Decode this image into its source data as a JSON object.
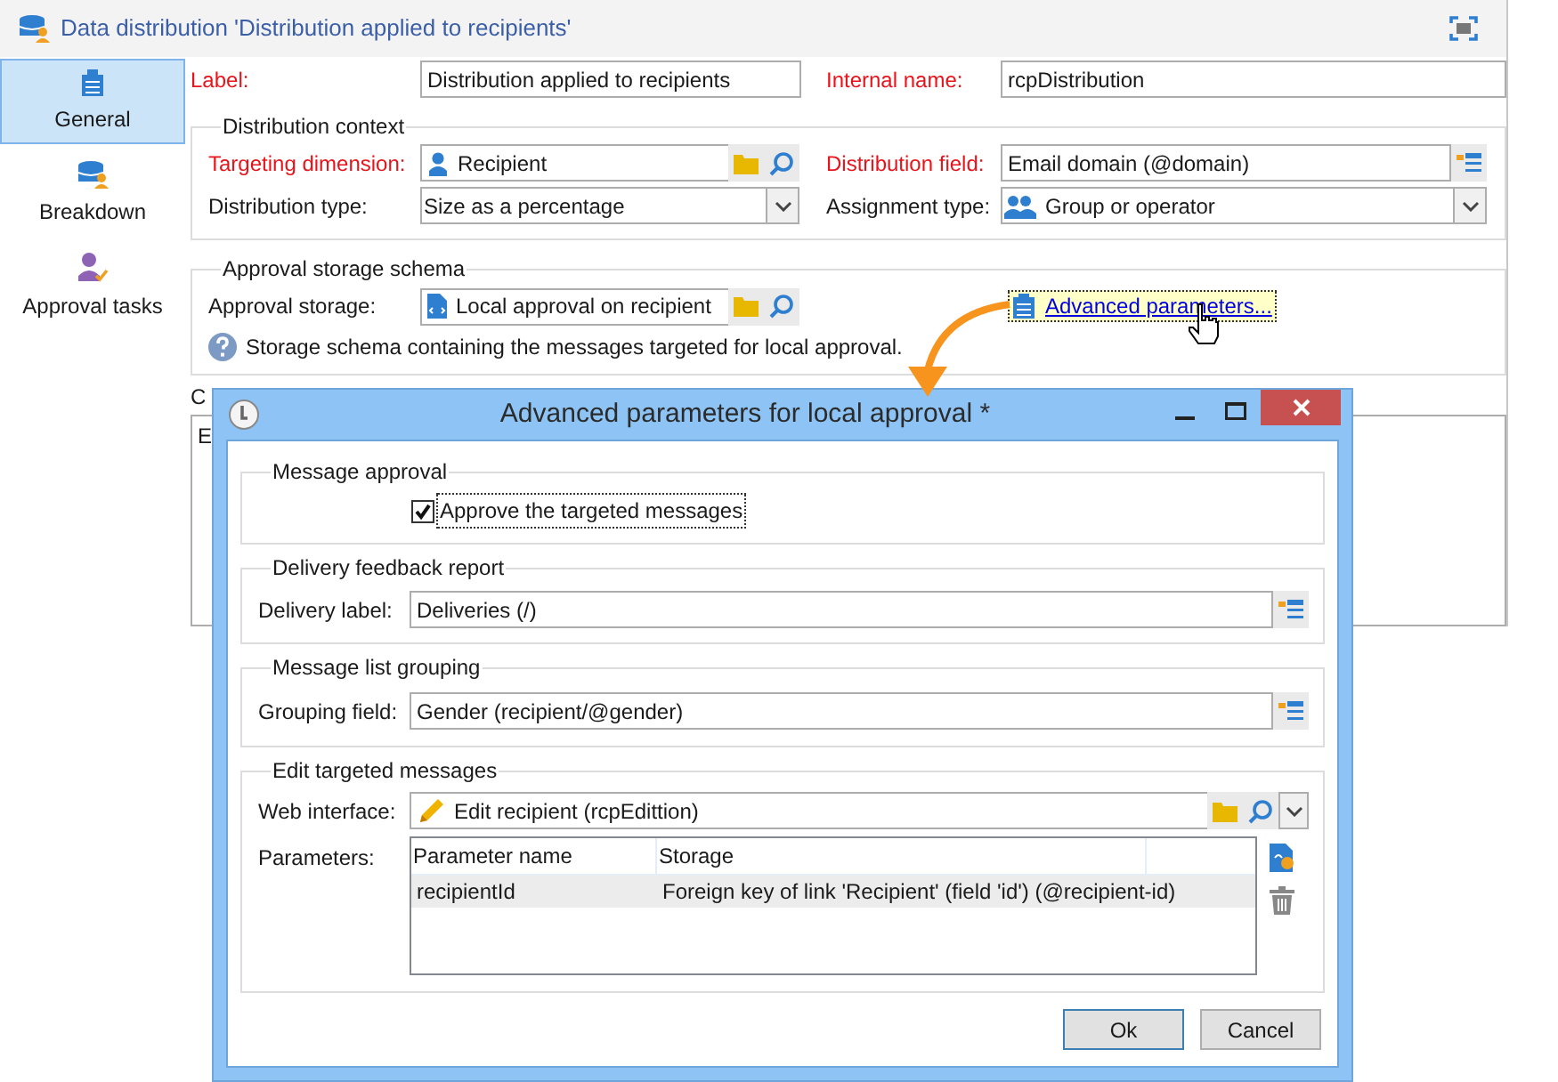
{
  "window": {
    "title": "Data distribution 'Distribution applied to recipients'"
  },
  "sidebar": {
    "items": [
      {
        "label": "General",
        "selected": true
      },
      {
        "label": "Breakdown",
        "selected": false
      },
      {
        "label": "Approval tasks",
        "selected": false
      }
    ]
  },
  "header_fields": [
    {
      "label": "Label:",
      "value": "Distribution applied to recipients",
      "required": true
    },
    {
      "label": "Internal name:",
      "value": "rcpDistribution",
      "required": true
    }
  ],
  "distribution_context": {
    "title": "Distribution context",
    "fields": [
      {
        "label": "Targeting dimension:",
        "value": "Recipient",
        "required": true,
        "kind": "link"
      },
      {
        "label": "Distribution field:",
        "value": "Email domain (@domain)",
        "required": true,
        "kind": "expression"
      },
      {
        "label": "Distribution type:",
        "value": "Size as a percentage",
        "required": false,
        "kind": "select"
      },
      {
        "label": "Assignment type:",
        "value": "Group or operator",
        "required": false,
        "kind": "select"
      }
    ]
  },
  "approval_storage": {
    "title": "Approval storage schema",
    "label": "Approval storage:",
    "value": "Local approval on recipient",
    "link": "Advanced parameters...",
    "help": "Storage schema containing the messages targeted for local approval."
  },
  "section_4": {
    "title": "C",
    "content": "E"
  },
  "dialog": {
    "title": "Advanced parameters for local approval *",
    "message_approval": {
      "title": "Message approval",
      "checkbox": {
        "label": "Approve the targeted messages",
        "checked": true
      }
    },
    "delivery_feedback": {
      "title": "Delivery feedback report",
      "label": "Delivery label:",
      "value": "Deliveries (/)"
    },
    "grouping": {
      "title": "Message list grouping",
      "label": "Grouping field:",
      "value": "Gender (recipient/@gender)"
    },
    "edit_messages": {
      "title": "Edit targeted messages",
      "web_interface": {
        "label": "Web interface:",
        "value": "Edit recipient (rcpEdittion)"
      },
      "parameters": {
        "label": "Parameters:",
        "columns": [
          "Parameter name",
          "Storage"
        ],
        "rows": [
          {
            "cells": [
              "recipientId",
              "Foreign key of link 'Recipient' (field 'id') (@recipient-id)"
            ],
            "selected": true
          }
        ]
      }
    },
    "buttons": [
      {
        "label": "Ok",
        "default": true
      },
      {
        "label": "Cancel",
        "default": false
      }
    ]
  }
}
